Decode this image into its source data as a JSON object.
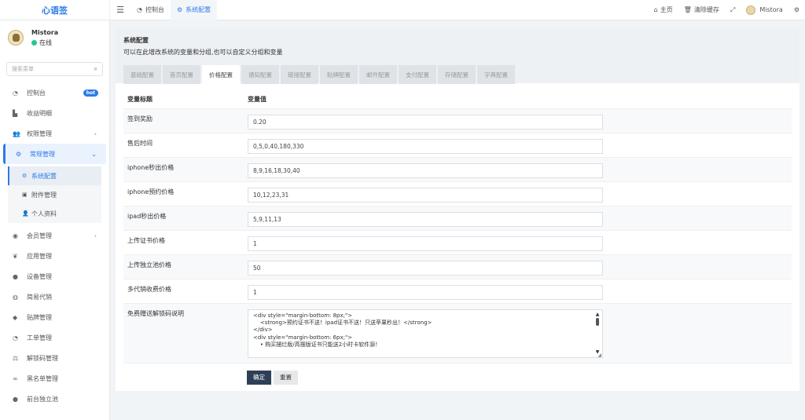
{
  "app": {
    "logo": "心语签"
  },
  "topbar": {
    "tabs": [
      {
        "icon": "dashboard-icon",
        "label": "控制台",
        "active": false
      },
      {
        "icon": "gears-icon",
        "label": "系统配置",
        "active": true
      }
    ],
    "right": {
      "home": "主页",
      "clear_cache": "清除缓存",
      "username": "Mistora"
    }
  },
  "sidebar": {
    "user": {
      "name": "Mistora",
      "status": "在线"
    },
    "search_placeholder": "搜索菜单",
    "items": [
      {
        "label": "控制台",
        "icon": "dashboard-icon",
        "badge": "hot"
      },
      {
        "label": "收益明细",
        "icon": "chart-icon"
      },
      {
        "label": "权限管理",
        "icon": "users-icon",
        "chevron": "‹"
      },
      {
        "label": "常规管理",
        "icon": "cogs-icon",
        "chevron": "⌄",
        "active": true
      },
      {
        "label": "会员管理",
        "icon": "user-circle-icon",
        "chevron": "‹"
      },
      {
        "label": "应用管理",
        "icon": "leaf-icon"
      },
      {
        "label": "设备管理",
        "icon": "circle-icon"
      },
      {
        "label": "简易代销",
        "icon": "circle-icon"
      },
      {
        "label": "贴牌管理",
        "icon": "tag-icon"
      },
      {
        "label": "工单管理",
        "icon": "dashboard-icon"
      },
      {
        "label": "解锁码管理",
        "icon": "balance-icon"
      },
      {
        "label": "黑名单管理",
        "icon": "bicycle-icon"
      },
      {
        "label": "前台独立池",
        "icon": "product-icon"
      }
    ],
    "subitems": [
      {
        "label": "系统配置",
        "icon": "cog-icon",
        "active": true
      },
      {
        "label": "附件管理",
        "icon": "file-image-icon"
      },
      {
        "label": "个人资料",
        "icon": "user-icon"
      }
    ]
  },
  "panel": {
    "title": "系统配置",
    "description": "可以在此增改系统的变量和分组,也可以自定义分组和变量",
    "tabs": [
      "基础配置",
      "首页配置",
      "价格配置",
      "通知配置",
      "链接配置",
      "贴牌配置",
      "邮件配置",
      "支付配置",
      "存储配置",
      "字典配置"
    ],
    "active_tab": 2
  },
  "table": {
    "headers": [
      "变量标题",
      "变量值"
    ],
    "rows": [
      {
        "title": "签到奖励",
        "value": "0.20"
      },
      {
        "title": "售后时间",
        "value": "0,5,0,40,180,330"
      },
      {
        "title": "iphone秒出价格",
        "value": "8,9,16,18,30,40"
      },
      {
        "title": "iphone预约价格",
        "value": "10,12,23,31"
      },
      {
        "title": "ipad秒出价格",
        "value": "5,9,11,13"
      },
      {
        "title": "上传证书价格",
        "value": "1"
      },
      {
        "title": "上传独立池价格",
        "value": "50"
      },
      {
        "title": "多代销收费价格",
        "value": "1"
      }
    ],
    "textarea_row": {
      "title": "免费赠送解锁码说明",
      "value": "<div style=\"margin-bottom: 8px;\">\n    <strong>预约证书不送！ipad证书不送！只送苹果秒出！</strong>\n</div>\n<div style=\"margin-bottom: 6px;\">\n    • 购买摆烂版/高摆版证书只能送2小时卡软件源！"
    }
  },
  "actions": {
    "confirm": "确定",
    "reset": "重置"
  }
}
